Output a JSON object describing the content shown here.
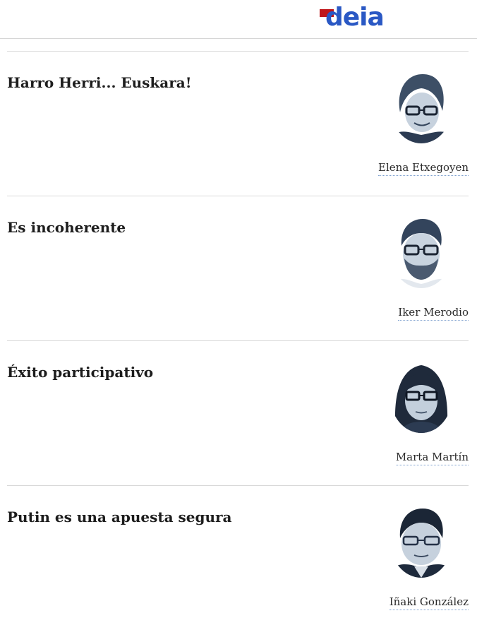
{
  "site": {
    "logo_text": "deia",
    "brand_color": "#2a58c4",
    "accent_color": "#c0161b"
  },
  "articles": [
    {
      "headline": "Harro Herri... Euskara!",
      "author": "Elena Etxegoyen",
      "avatar_icon": "author-portrait"
    },
    {
      "headline": "Es incoherente",
      "author": "Iker Merodio",
      "avatar_icon": "author-portrait"
    },
    {
      "headline": "Éxito participativo",
      "author": "Marta Martín",
      "avatar_icon": "author-portrait"
    },
    {
      "headline": "Putin es una apuesta segura",
      "author": "Iñaki González",
      "avatar_icon": "author-portrait"
    }
  ]
}
